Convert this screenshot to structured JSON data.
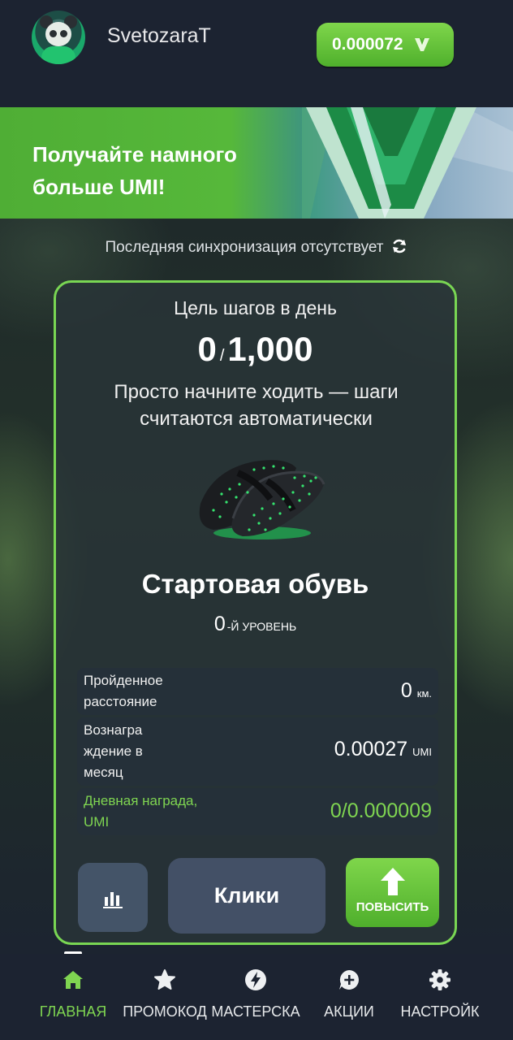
{
  "header": {
    "username": "SvetozaraT",
    "balance": "0.000072"
  },
  "banner": {
    "text": "Получайте намного больше UMI!"
  },
  "sync": {
    "text": "Последняя синхронизация отсутствует"
  },
  "card": {
    "goal_label": "Цель шагов в день",
    "steps_current": "0",
    "steps_separator": "/",
    "steps_goal": "1,000",
    "hint": "Просто начните ходить — шаги считаются автоматически",
    "shoe_name": "Стартовая обувь",
    "level_num": "0",
    "level_label": "-Й УРОВЕНЬ",
    "stats": [
      {
        "label": "Пройденное расстояние",
        "value": "0",
        "unit": "км."
      },
      {
        "label": "Вознагра ждение в месяц",
        "value": "0.00027",
        "unit": "UMI"
      },
      {
        "label": "Дневная награда, UMI",
        "value": "0/0.000009",
        "unit": ""
      }
    ],
    "clicks_button": "Клики",
    "upgrade_button": "ПОВЫСИТЬ"
  },
  "nav": {
    "items": [
      {
        "label": "ГЛАВНАЯ",
        "icon": "home-icon",
        "active": true
      },
      {
        "label": "ПРОМОКОД",
        "icon": "star-icon",
        "active": false
      },
      {
        "label": "МАСТЕРСКА",
        "icon": "bolt-icon",
        "active": false
      },
      {
        "label": "АКЦИИ",
        "icon": "chat-plus-icon",
        "active": false
      },
      {
        "label": "НАСТРОЙК",
        "icon": "gear-icon",
        "active": false
      }
    ]
  },
  "colors": {
    "accent_green": "#7fd551",
    "background": "#1c2331",
    "button_gray": "#435066"
  }
}
